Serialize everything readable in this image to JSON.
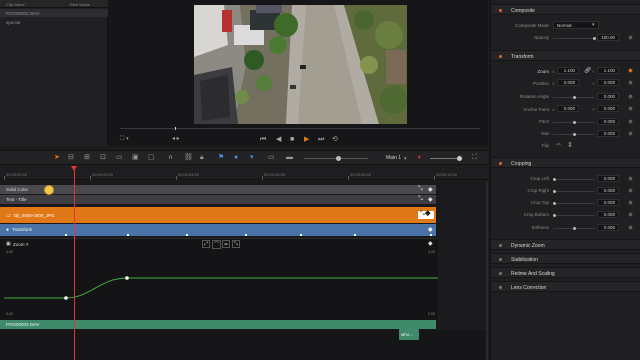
{
  "media_pool": {
    "columns": [
      "Clip Name",
      "Reel Name"
    ],
    "items": [
      "POO00003.WAV",
      "special"
    ]
  },
  "timeline": {
    "name": "Main 1",
    "ruler": [
      "00:00:00:00",
      "00:00:02:00",
      "00:00:04:00",
      "00:00:06:00",
      "00:00:08:00",
      "00:00:10:00"
    ],
    "tracks": {
      "solid_color": "Solid Color",
      "text_title": "Text - Title",
      "video_clip": "Dji_0009-0000_JPG",
      "transform": "Transform",
      "zoom_y": "Zoom Y",
      "curve_top": "4.00",
      "curve_bottom": "0.00",
      "curve_top_right": "4.00",
      "curve_bottom_right": "0.00",
      "audio_clip": "POO00003.WAV",
      "small_clip": "who..."
    }
  },
  "inspector": {
    "composite": {
      "title": "Composite",
      "mode_label": "Composite Mode",
      "mode_value": "Normal",
      "opacity_label": "Opacity",
      "opacity_value": "100.00"
    },
    "transform": {
      "title": "Transform",
      "zoom_label": "Zoom",
      "zoom_x": "1.100",
      "zoom_y": "1.100",
      "position_label": "Position",
      "pos_x": "0.000",
      "pos_y": "0.000",
      "rotation_label": "Rotation Angle",
      "rotation_value": "0.000",
      "anchor_label": "Anchor Point",
      "anchor_x": "0.000",
      "anchor_y": "0.000",
      "pitch_label": "Pitch",
      "pitch_value": "0.000",
      "yaw_label": "Yaw",
      "yaw_value": "0.000",
      "flip_label": "Flip",
      "x_axis": "X",
      "y_axis": "Y"
    },
    "cropping": {
      "title": "Cropping",
      "left_label": "Crop Left",
      "left_value": "0.000",
      "right_label": "Crop Right",
      "right_value": "0.000",
      "top_label": "Crop Top",
      "top_value": "0.000",
      "bottom_label": "Crop Bottom",
      "bottom_value": "0.000",
      "softness_label": "Softness",
      "softness_value": "0.000"
    },
    "sections": [
      "Dynamic Zoom",
      "Stabilization",
      "Retime And Scaling",
      "Lens Correction"
    ]
  },
  "colors": {
    "accent": "#e0682a",
    "clip_orange": "#e07818",
    "transform_blue": "#4a74a8",
    "audio_green": "#3e8a6a",
    "playhead": "#e0363a",
    "curve_green": "#3fae3f"
  }
}
